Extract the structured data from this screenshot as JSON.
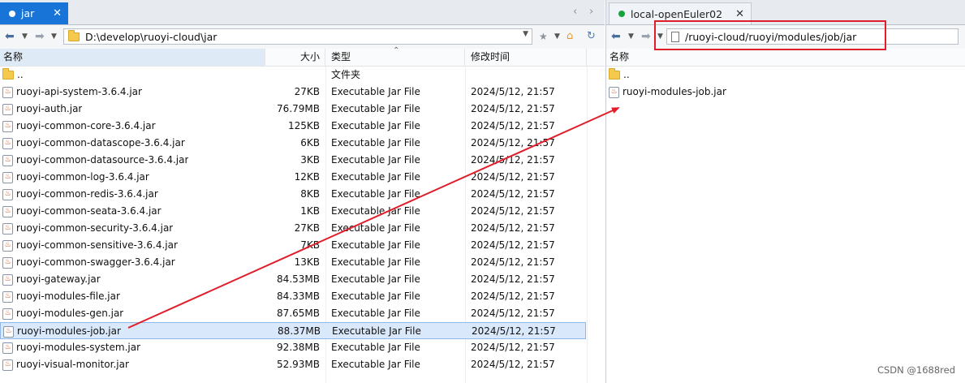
{
  "left_pane": {
    "tab": {
      "label": "jar",
      "dot_color": "#ffffff"
    },
    "path": "D:\\develop\\ruoyi-cloud\\jar",
    "columns": {
      "name": "名称",
      "size": "大小",
      "type": "类型",
      "date": "修改时间"
    },
    "rows": [
      {
        "name": "..",
        "size": "",
        "type": "文件夹",
        "date": "",
        "kind": "folder"
      },
      {
        "name": "ruoyi-api-system-3.6.4.jar",
        "size": "27KB",
        "type": "Executable Jar File",
        "date": "2024/5/12, 21:57",
        "kind": "jar"
      },
      {
        "name": "ruoyi-auth.jar",
        "size": "76.79MB",
        "type": "Executable Jar File",
        "date": "2024/5/12, 21:57",
        "kind": "jar"
      },
      {
        "name": "ruoyi-common-core-3.6.4.jar",
        "size": "125KB",
        "type": "Executable Jar File",
        "date": "2024/5/12, 21:57",
        "kind": "jar"
      },
      {
        "name": "ruoyi-common-datascope-3.6.4.jar",
        "size": "6KB",
        "type": "Executable Jar File",
        "date": "2024/5/12, 21:57",
        "kind": "jar"
      },
      {
        "name": "ruoyi-common-datasource-3.6.4.jar",
        "size": "3KB",
        "type": "Executable Jar File",
        "date": "2024/5/12, 21:57",
        "kind": "jar"
      },
      {
        "name": "ruoyi-common-log-3.6.4.jar",
        "size": "12KB",
        "type": "Executable Jar File",
        "date": "2024/5/12, 21:57",
        "kind": "jar"
      },
      {
        "name": "ruoyi-common-redis-3.6.4.jar",
        "size": "8KB",
        "type": "Executable Jar File",
        "date": "2024/5/12, 21:57",
        "kind": "jar"
      },
      {
        "name": "ruoyi-common-seata-3.6.4.jar",
        "size": "1KB",
        "type": "Executable Jar File",
        "date": "2024/5/12, 21:57",
        "kind": "jar"
      },
      {
        "name": "ruoyi-common-security-3.6.4.jar",
        "size": "27KB",
        "type": "Executable Jar File",
        "date": "2024/5/12, 21:57",
        "kind": "jar"
      },
      {
        "name": "ruoyi-common-sensitive-3.6.4.jar",
        "size": "7KB",
        "type": "Executable Jar File",
        "date": "2024/5/12, 21:57",
        "kind": "jar"
      },
      {
        "name": "ruoyi-common-swagger-3.6.4.jar",
        "size": "13KB",
        "type": "Executable Jar File",
        "date": "2024/5/12, 21:57",
        "kind": "jar"
      },
      {
        "name": "ruoyi-gateway.jar",
        "size": "84.53MB",
        "type": "Executable Jar File",
        "date": "2024/5/12, 21:57",
        "kind": "jar"
      },
      {
        "name": "ruoyi-modules-file.jar",
        "size": "84.33MB",
        "type": "Executable Jar File",
        "date": "2024/5/12, 21:57",
        "kind": "jar"
      },
      {
        "name": "ruoyi-modules-gen.jar",
        "size": "87.65MB",
        "type": "Executable Jar File",
        "date": "2024/5/12, 21:57",
        "kind": "jar"
      },
      {
        "name": "ruoyi-modules-job.jar",
        "size": "88.37MB",
        "type": "Executable Jar File",
        "date": "2024/5/12, 21:57",
        "kind": "jar",
        "selected": true
      },
      {
        "name": "ruoyi-modules-system.jar",
        "size": "92.38MB",
        "type": "Executable Jar File",
        "date": "2024/5/12, 21:57",
        "kind": "jar"
      },
      {
        "name": "ruoyi-visual-monitor.jar",
        "size": "52.93MB",
        "type": "Executable Jar File",
        "date": "2024/5/12, 21:57",
        "kind": "jar"
      }
    ]
  },
  "right_pane": {
    "tab": {
      "label": "local-openEuler02",
      "dot_color": "#1aa33b"
    },
    "path": "/ruoyi-cloud/ruoyi/modules/job/jar",
    "columns": {
      "name": "名称"
    },
    "rows": [
      {
        "name": "..",
        "kind": "folder"
      },
      {
        "name": "ruoyi-modules-job.jar",
        "kind": "jar"
      }
    ]
  },
  "icons": {
    "back": "back-arrow-icon",
    "forward": "forward-arrow-icon",
    "close": "close-icon",
    "home": "home-icon",
    "refresh": "refresh-icon",
    "bookmark": "star-icon"
  },
  "annotation_color": "#e01e2b",
  "watermark": "CSDN @1688red"
}
